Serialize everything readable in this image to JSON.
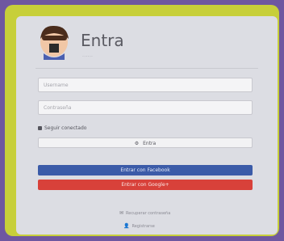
{
  "login": {
    "title": "Entra",
    "subtitle": "......",
    "username_placeholder": "Username",
    "password_placeholder": "Contraseña",
    "remember_label": "Seguir conectado",
    "enter_label": "Entra",
    "facebook_label": "Entrar con Facebook",
    "google_label": "Entrar con Google+",
    "forgot_label": "Recuperar contraseña",
    "register_label": "Registrarse"
  },
  "icons": {
    "avatar": "user-avatar-icon",
    "enter": "gear-icon",
    "forgot": "envelope-icon",
    "register": "user-icon"
  },
  "colors": {
    "outer_bg": "#6e57a0",
    "frame": "#c7cf3a",
    "card": "#dcdde3",
    "facebook": "#3b5ba8",
    "google": "#d8413a"
  }
}
